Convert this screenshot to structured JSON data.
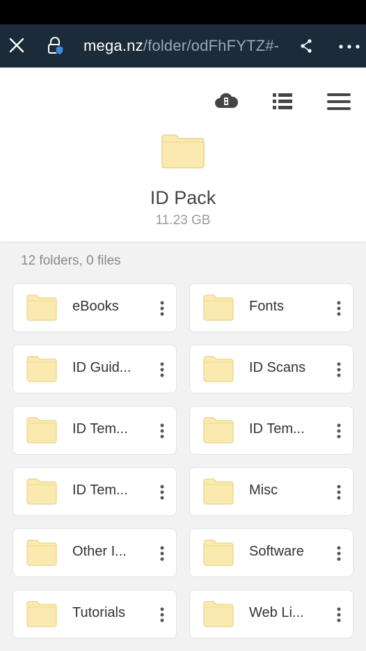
{
  "browser": {
    "url_domain": "mega.nz",
    "url_path": "/folder/odFhFYTZ#-"
  },
  "folder": {
    "name": "ID Pack",
    "size": "11.23 GB"
  },
  "summary": "12 folders, 0 files",
  "colors": {
    "browser_bar": "#1c2b3a",
    "folder_fill": "#fbeaaf",
    "folder_stroke": "#e8d38a"
  },
  "items": [
    {
      "name": "eBooks"
    },
    {
      "name": "Fonts"
    },
    {
      "name": "ID Guid..."
    },
    {
      "name": "ID Scans"
    },
    {
      "name": "ID Tem..."
    },
    {
      "name": "ID Tem..."
    },
    {
      "name": "ID Tem..."
    },
    {
      "name": "Misc"
    },
    {
      "name": "Other I..."
    },
    {
      "name": "Software"
    },
    {
      "name": "Tutorials"
    },
    {
      "name": "Web Li..."
    }
  ]
}
